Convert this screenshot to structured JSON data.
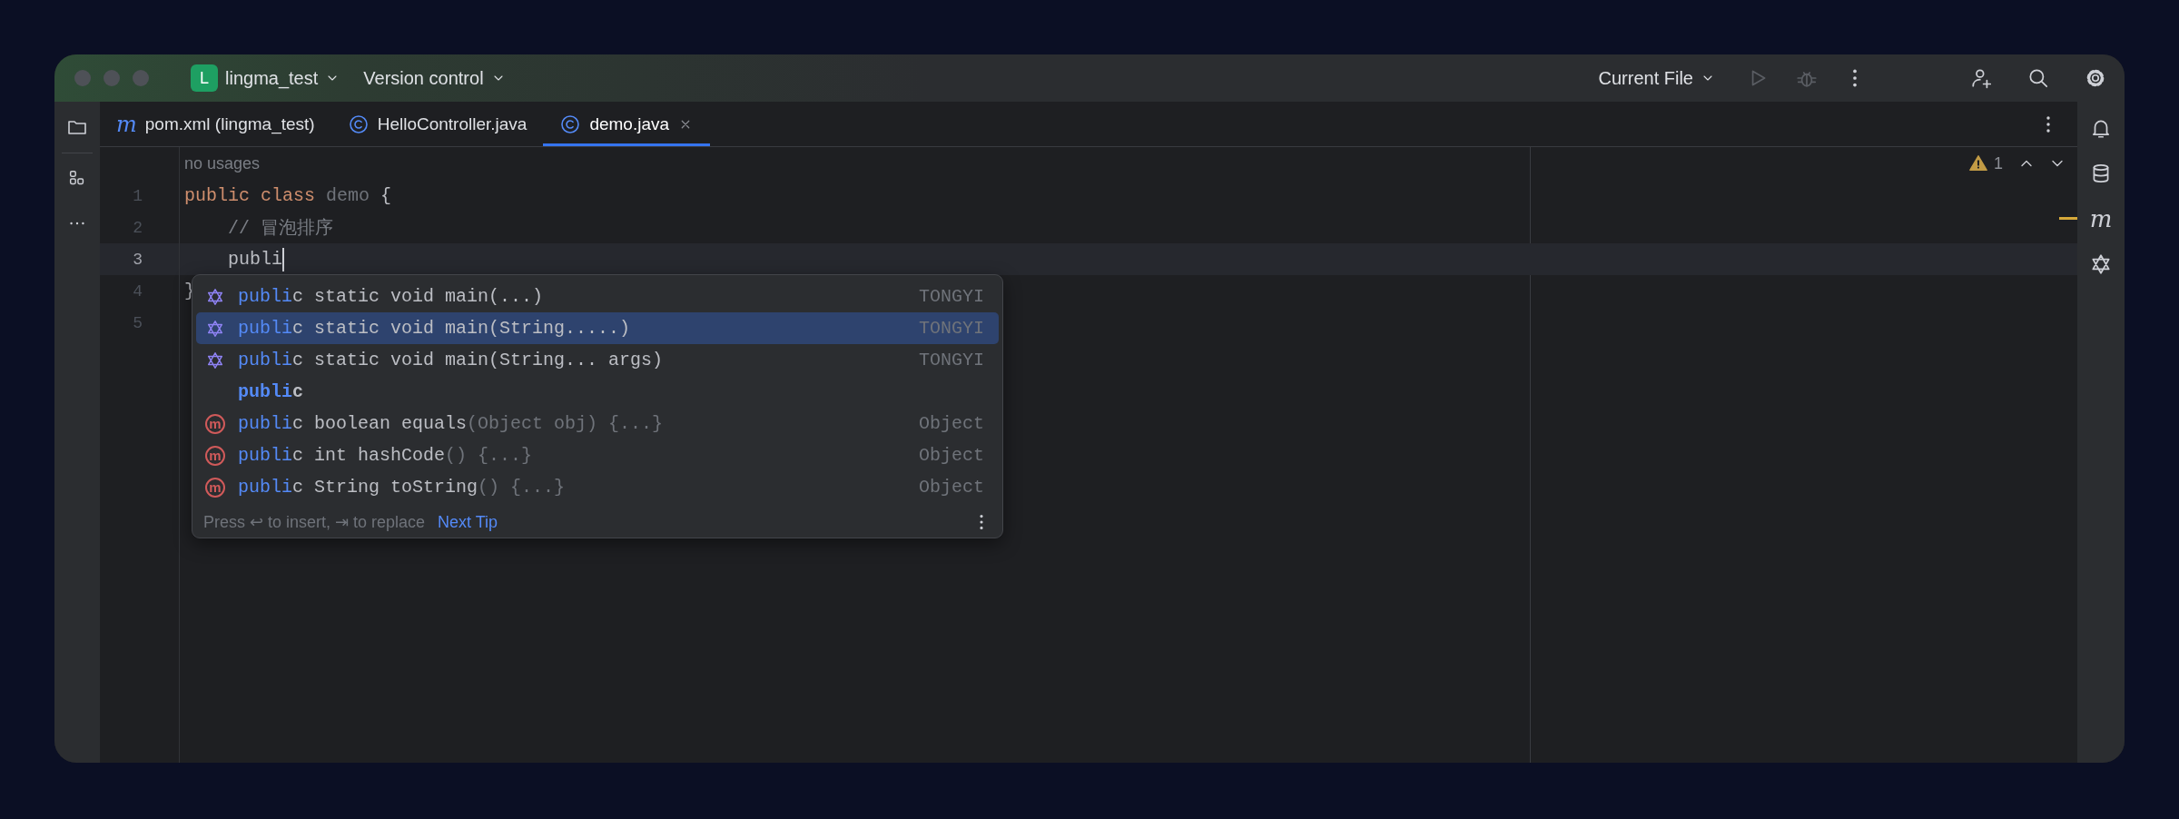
{
  "title_bar": {
    "project_initial": "L",
    "project_name": "lingma_test",
    "vcs_widget": "Version control",
    "run_configuration": "Current File"
  },
  "editor_tabs": [
    {
      "kind": "letter",
      "icon_text": "m",
      "label": "pom.xml (lingma_test)",
      "selected": false,
      "closable": false
    },
    {
      "kind": "class",
      "label": "HelloController.java",
      "selected": false,
      "closable": false
    },
    {
      "kind": "class",
      "label": "demo.java",
      "selected": true,
      "closable": true
    }
  ],
  "right_toolbar": [
    {
      "kind": "bell"
    },
    {
      "kind": "database"
    },
    {
      "kind": "letter",
      "text": "m"
    },
    {
      "kind": "hexagram"
    }
  ],
  "editor": {
    "inlay_hint": "no usages",
    "warning_count": "1",
    "lines": [
      {
        "number": "1",
        "current": false,
        "tokens": [
          {
            "text": "public",
            "kind": "keyword"
          },
          {
            "text": " class",
            "kind": "keyword"
          },
          {
            "text": " demo",
            "kind": "unused"
          },
          {
            "text": " {",
            "kind": "plain"
          }
        ]
      },
      {
        "number": "2",
        "current": false,
        "tokens": [
          {
            "text": "    // 冒泡排序",
            "kind": "comment"
          }
        ]
      },
      {
        "number": "3",
        "current": true,
        "caret": true,
        "tokens": [
          {
            "text": "    publi",
            "kind": "plain"
          }
        ]
      },
      {
        "number": "4",
        "current": false,
        "tokens": [
          {
            "text": "}",
            "kind": "plain"
          }
        ]
      },
      {
        "number": "5",
        "current": false
      }
    ]
  },
  "completion": {
    "items": [
      {
        "kind": "ai",
        "match": "publi",
        "text": "c static void main(...)",
        "source": "TONGYI",
        "selected": false
      },
      {
        "kind": "ai",
        "match": "publi",
        "text": "c static void main(String.....)",
        "source": "TONGYI",
        "selected": true
      },
      {
        "kind": "ai",
        "match": "publi",
        "text": "c static void main(String... args)",
        "source": "TONGYI",
        "selected": false
      },
      {
        "kind": "keyword",
        "match": "publi",
        "text": "c",
        "selected": false
      },
      {
        "kind": "method",
        "icon_text": "m",
        "match": "publi",
        "text": "c boolean equals",
        "params": "(Object obj) {...}",
        "source": "Object",
        "selected": false
      },
      {
        "kind": "method",
        "icon_text": "m",
        "match": "publi",
        "text": "c int hashCode",
        "params": "() {...}",
        "source": "Object",
        "selected": false
      },
      {
        "kind": "method",
        "icon_text": "m",
        "match": "publi",
        "text": "c String toString",
        "params": "() {...}",
        "source": "Object",
        "selected": false
      }
    ],
    "footer": {
      "hint": "Press ↩ to insert, ⇥ to replace",
      "link": "Next Tip"
    }
  }
}
